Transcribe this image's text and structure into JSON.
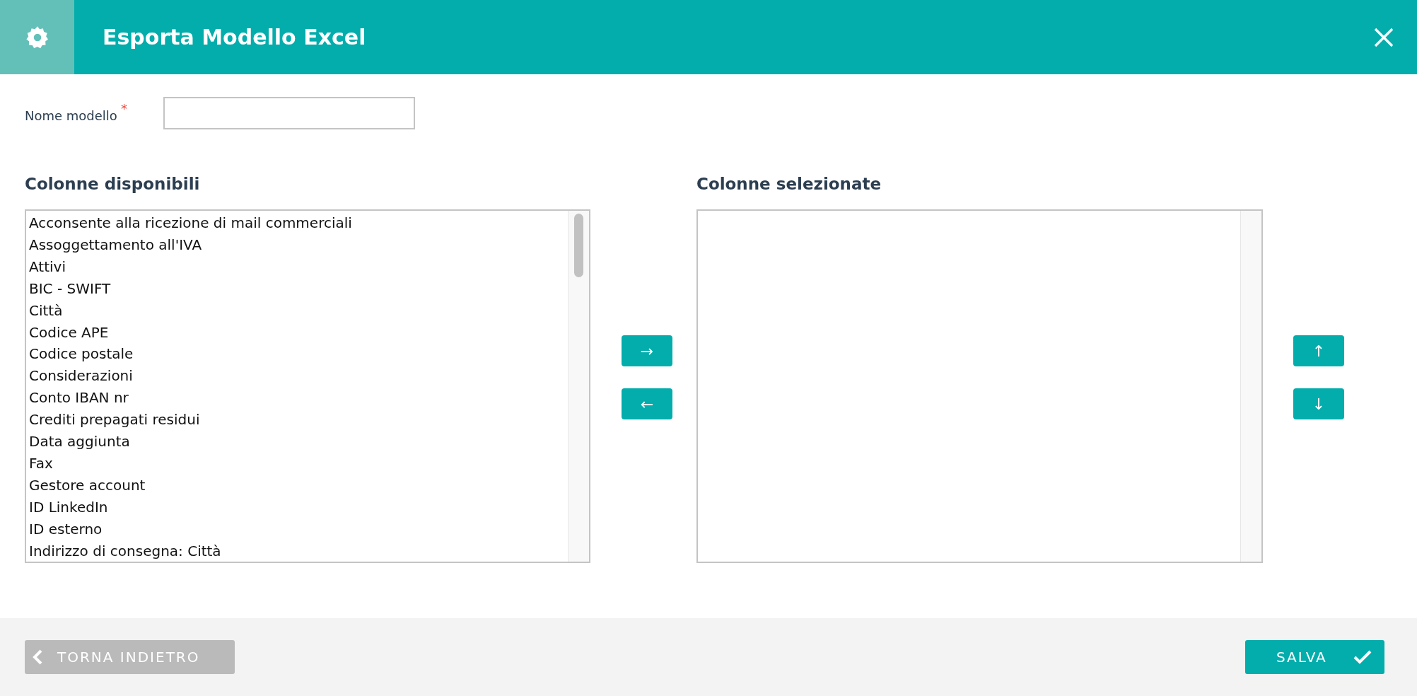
{
  "dialog": {
    "title": "Esporta Modello Excel"
  },
  "form": {
    "label": "Nome modello",
    "required_mark": "*"
  },
  "available": {
    "heading": "Colonne disponibili",
    "items": [
      {
        "label": "Acconsente alla ricezione di mail commerciali",
        "selected": false
      },
      {
        "label": "Assoggettamento all'IVA",
        "selected": false
      },
      {
        "label": "Attivi",
        "selected": false
      },
      {
        "label": "BIC - SWIFT",
        "selected": false
      },
      {
        "label": "Città",
        "selected": false
      },
      {
        "label": "Codice APE",
        "selected": false
      },
      {
        "label": "Codice postale",
        "selected": false
      },
      {
        "label": "Considerazioni",
        "selected": false
      },
      {
        "label": "Conto IBAN nr",
        "selected": false
      },
      {
        "label": "Crediti prepagati residui",
        "selected": false
      },
      {
        "label": "Data aggiunta",
        "selected": false
      },
      {
        "label": "Fax",
        "selected": false
      },
      {
        "label": "Gestore account",
        "selected": false
      },
      {
        "label": "ID LinkedIn",
        "selected": false
      },
      {
        "label": "ID esterno",
        "selected": false
      },
      {
        "label": "Indirizzo di consegna: Città",
        "selected": false
      }
    ]
  },
  "transfer_buttons": [
    "→",
    "←"
  ],
  "selected": {
    "heading": "Colonne selezionate"
  },
  "order_buttons": [
    "↑",
    "↓"
  ],
  "footer": {
    "back": {
      "label": "TORNA INDIETRO",
      "disabled": true
    },
    "save": {
      "label": "SALVA",
      "disabled": false
    }
  }
}
